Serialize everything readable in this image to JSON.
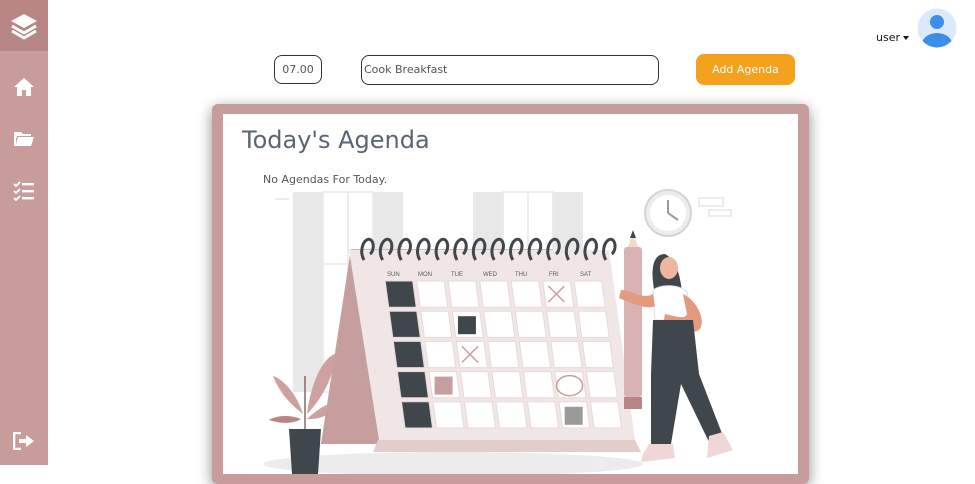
{
  "user": {
    "name": "user"
  },
  "form": {
    "time_value": "07.00",
    "task_value": "Cook Breakfast",
    "add_label": "Add Agenda"
  },
  "agenda": {
    "title": "Today's Agenda",
    "empty_message": "No Agendas For Today."
  },
  "calendar_days": [
    "SUN",
    "MON",
    "TUE",
    "WED",
    "THU",
    "FRI",
    "SAT"
  ],
  "colors": {
    "sidebar": "#c99c9c",
    "sidebar_active": "#b88585",
    "accent": "#f4a11d",
    "avatar": "#3d8ee8"
  },
  "icons": {
    "logo": "layers-icon",
    "nav": [
      "home-icon",
      "folder-icon",
      "checklist-icon"
    ],
    "logout": "logout-icon"
  }
}
